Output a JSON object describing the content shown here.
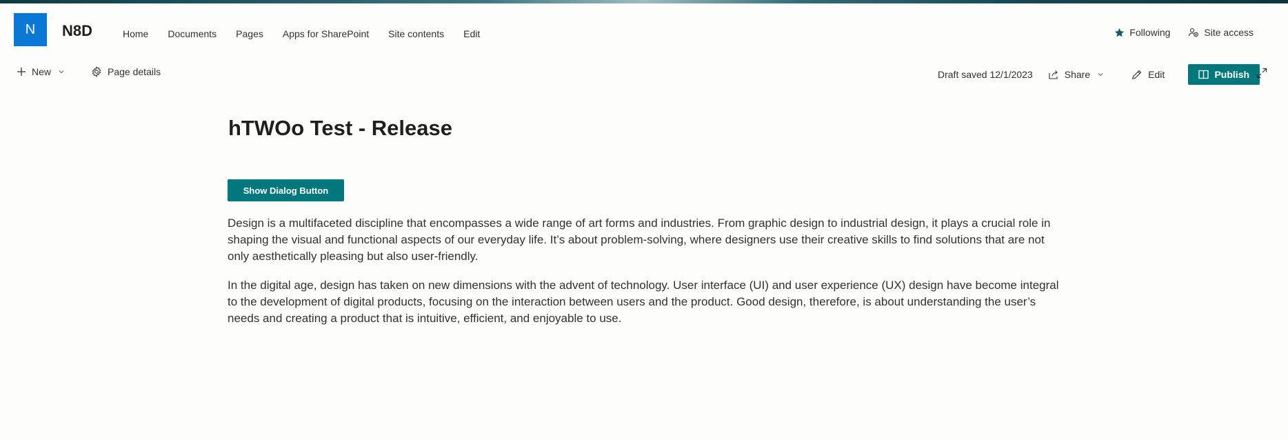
{
  "site": {
    "logo_letter": "N",
    "title": "N8D",
    "nav": [
      "Home",
      "Documents",
      "Pages",
      "Apps for SharePoint",
      "Site contents",
      "Edit"
    ],
    "following_label": "Following",
    "site_access_label": "Site access"
  },
  "command_bar": {
    "new_label": "New",
    "page_details_label": "Page details",
    "draft_status": "Draft saved 12/1/2023",
    "share_label": "Share",
    "edit_label": "Edit",
    "publish_label": "Publish"
  },
  "page": {
    "title": "hTWOo Test - Release",
    "button_label": "Show Dialog Button",
    "paragraphs": [
      "Design is a multifaceted discipline that encompasses a wide range of art forms and industries. From graphic design to industrial design, it plays a crucial role in shaping the visual and functional aspects of our everyday life. It’s about problem-solving, where designers use their creative skills to find solutions that are not only aesthetically pleasing but also user-friendly.",
      "In the digital age, design has taken on new dimensions with the advent of technology. User interface (UI) and user experience (UX) design have become integral to the development of digital products, focusing on the interaction between users and the product. Good design, therefore, is about understanding the user’s needs and creating a product that is intuitive, efficient, and enjoyable to use."
    ]
  },
  "colors": {
    "accent": "#03787c",
    "logo": "#0a78d4",
    "text": "#323130"
  },
  "icons": [
    "add-icon",
    "chevron-down-icon",
    "gear-icon",
    "star-icon",
    "people-icon",
    "share-icon",
    "pencil-icon",
    "book-icon",
    "expand-icon"
  ]
}
